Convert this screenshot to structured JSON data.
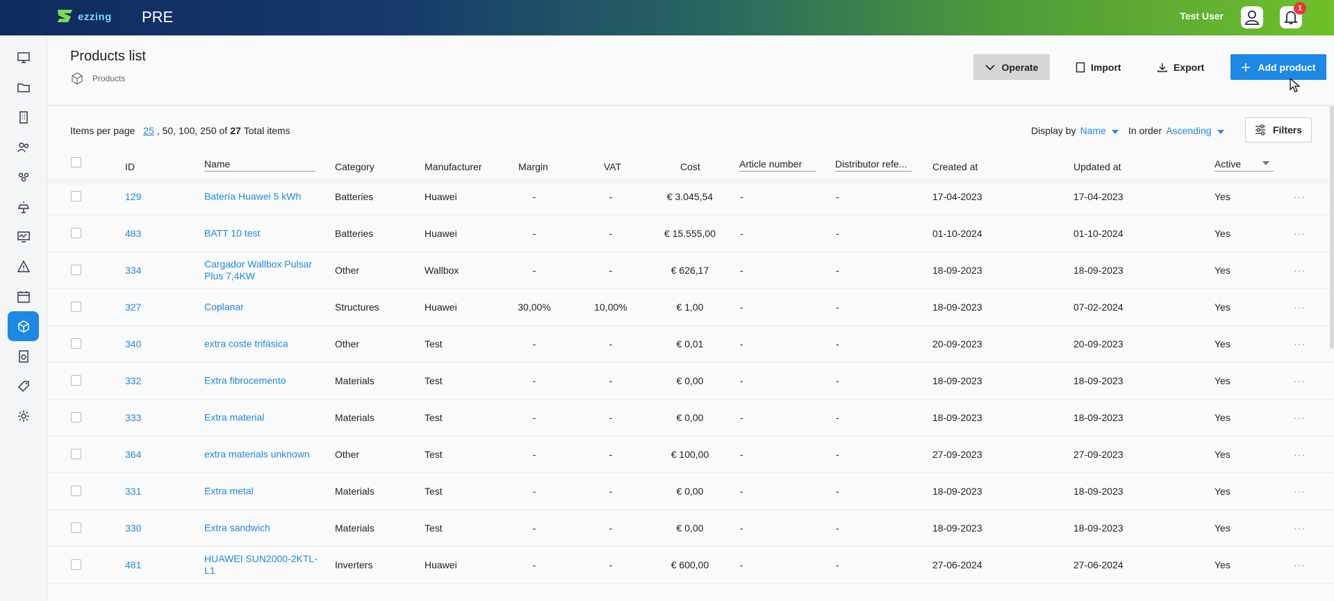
{
  "app": {
    "logo_text": "ezzing",
    "env_label": "PRE",
    "user_name": "Test User",
    "notifications_count": "1"
  },
  "header": {
    "title": "Products list",
    "breadcrumb": "Products",
    "operate_label": "Operate",
    "import_label": "Import",
    "export_label": "Export",
    "add_label": "Add product"
  },
  "toolbar": {
    "items_per_page_label": "Items per page",
    "page_size_selected": "25",
    "page_size_others": ", 50, 100, 250",
    "of_label": "of",
    "total_count": "27",
    "total_label": "Total items",
    "display_by_label": "Display by",
    "display_by_value": "Name",
    "in_order_label": "In order",
    "in_order_value": "Ascending",
    "filters_label": "Filters"
  },
  "columns": {
    "id": "ID",
    "name": "Name",
    "category": "Category",
    "manufacturer": "Manufacturer",
    "margin": "Margin",
    "vat": "VAT",
    "cost": "Cost",
    "article": "Article number",
    "distributor": "Distributor refe...",
    "created": "Created at",
    "updated": "Updated at",
    "active": "Active"
  },
  "rows": [
    {
      "id": "129",
      "name1": "Batería Huawei 5 kWh",
      "name2": "",
      "category": "Batteries",
      "manufacturer": "Huawei",
      "margin": "-",
      "vat": "-",
      "cost": "€ 3.045,54",
      "article": "-",
      "distributor": "-",
      "created": "17-04-2023",
      "updated": "17-04-2023",
      "active": "Yes"
    },
    {
      "id": "483",
      "name1": "BATT 10 test",
      "name2": "",
      "category": "Batteries",
      "manufacturer": "Huawei",
      "margin": "-",
      "vat": "-",
      "cost": "€ 15.555,00",
      "article": "-",
      "distributor": "-",
      "created": "01-10-2024",
      "updated": "01-10-2024",
      "active": "Yes"
    },
    {
      "id": "334",
      "name1": "Cargador Wallbox Pulsar",
      "name2": "Plus 7,4KW",
      "category": "Other",
      "manufacturer": "Wallbox",
      "margin": "-",
      "vat": "-",
      "cost": "€ 626,17",
      "article": "-",
      "distributor": "-",
      "created": "18-09-2023",
      "updated": "18-09-2023",
      "active": "Yes"
    },
    {
      "id": "327",
      "name1": "Coplanar",
      "name2": "",
      "category": "Structures",
      "manufacturer": "Huawei",
      "margin": "30,00%",
      "vat": "10,00%",
      "cost": "€ 1,00",
      "article": "-",
      "distributor": "-",
      "created": "18-09-2023",
      "updated": "07-02-2024",
      "active": "Yes"
    },
    {
      "id": "340",
      "name1": "extra coste trifásica",
      "name2": "",
      "category": "Other",
      "manufacturer": "Test",
      "margin": "-",
      "vat": "-",
      "cost": "€ 0,01",
      "article": "-",
      "distributor": "-",
      "created": "20-09-2023",
      "updated": "20-09-2023",
      "active": "Yes"
    },
    {
      "id": "332",
      "name1": "Extra fibrocemento",
      "name2": "",
      "category": "Materials",
      "manufacturer": "Test",
      "margin": "-",
      "vat": "-",
      "cost": "€ 0,00",
      "article": "-",
      "distributor": "-",
      "created": "18-09-2023",
      "updated": "18-09-2023",
      "active": "Yes"
    },
    {
      "id": "333",
      "name1": "Extra material",
      "name2": "",
      "category": "Materials",
      "manufacturer": "Test",
      "margin": "-",
      "vat": "-",
      "cost": "€ 0,00",
      "article": "-",
      "distributor": "-",
      "created": "18-09-2023",
      "updated": "18-09-2023",
      "active": "Yes"
    },
    {
      "id": "364",
      "name1": "extra materials unknown",
      "name2": "",
      "category": "Other",
      "manufacturer": "Test",
      "margin": "-",
      "vat": "-",
      "cost": "€ 100,00",
      "article": "-",
      "distributor": "-",
      "created": "27-09-2023",
      "updated": "27-09-2023",
      "active": "Yes"
    },
    {
      "id": "331",
      "name1": "Extra metal",
      "name2": "",
      "category": "Materials",
      "manufacturer": "Test",
      "margin": "-",
      "vat": "-",
      "cost": "€ 0,00",
      "article": "-",
      "distributor": "-",
      "created": "18-09-2023",
      "updated": "18-09-2023",
      "active": "Yes"
    },
    {
      "id": "330",
      "name1": "Extra sandwich",
      "name2": "",
      "category": "Materials",
      "manufacturer": "Test",
      "margin": "-",
      "vat": "-",
      "cost": "€ 0,00",
      "article": "-",
      "distributor": "-",
      "created": "18-09-2023",
      "updated": "18-09-2023",
      "active": "Yes"
    },
    {
      "id": "481",
      "name1": "HUAWEI SUN2000-2KTL-",
      "name2": "L1",
      "category": "Inverters",
      "manufacturer": "Huawei",
      "margin": "-",
      "vat": "-",
      "cost": "€ 600,00",
      "article": "-",
      "distributor": "-",
      "created": "27-06-2024",
      "updated": "27-06-2024",
      "active": "Yes"
    }
  ],
  "more_glyph": "···",
  "sidebar_icons": [
    "dashboard-icon",
    "folder-icon",
    "building-icon",
    "team-icon",
    "users-icon",
    "solar-icon",
    "monitor-icon",
    "alert-icon",
    "calendar-icon",
    "products-icon",
    "invoice-icon",
    "tag-icon",
    "settings-icon"
  ],
  "colors": {
    "accent": "#1e88e5",
    "operate_bg": "#d6d6d6"
  }
}
